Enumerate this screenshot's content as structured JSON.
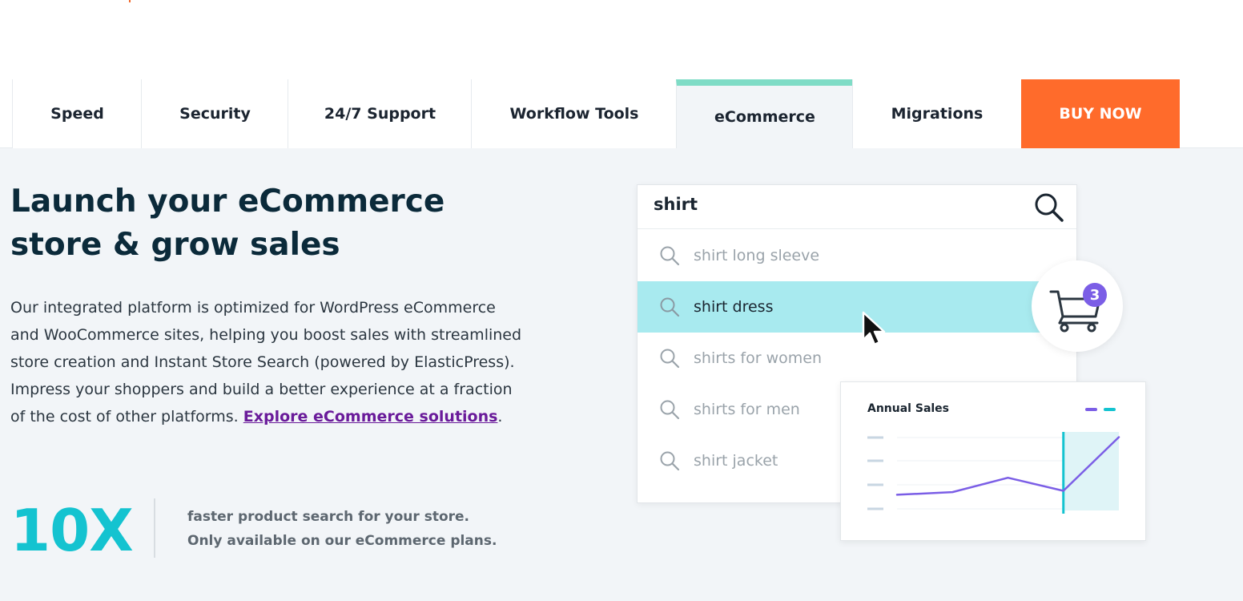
{
  "nav": {
    "tabs": [
      {
        "label": "Speed"
      },
      {
        "label": "Security"
      },
      {
        "label": "24/7 Support"
      },
      {
        "label": "Workflow Tools"
      },
      {
        "label": "eCommerce"
      },
      {
        "label": "Migrations"
      }
    ],
    "buy_label": "BUY NOW",
    "active_tab": "eCommerce"
  },
  "hero": {
    "title_line1": "Launch your eCommerce",
    "title_line2": "store & grow sales",
    "description": "Our integrated platform is optimized for WordPress eCommerce and WooCommerce sites, helping you boost sales with streamlined store creation and Instant Store Search (powered by ElasticPress). Impress your shoppers and build a better experience at a fraction of the cost of other platforms.",
    "link_text": "Explore eCommerce solutions",
    "after_link": "."
  },
  "stat": {
    "value": "10X",
    "text": "faster product search for your store. Only available on our eCommerce plans."
  },
  "search_demo": {
    "query": "shirt",
    "suggestions": [
      "shirt long sleeve",
      "shirt dress",
      "shirts for women",
      "shirts for men",
      "shirt jacket"
    ],
    "highlighted_index": 1
  },
  "cart": {
    "count": "3"
  },
  "chart_data": {
    "type": "line",
    "title": "Annual Sales",
    "series": [
      {
        "values": [
          1.2,
          1.4,
          2.5,
          1.5,
          5.6
        ],
        "color": "#7b5ee6"
      }
    ],
    "legend_colors": [
      "#7b5ee6",
      "#14c3d0"
    ],
    "highlight_from_index": 3,
    "highlight_color": "#14c3d0"
  },
  "colors": {
    "accent_orange": "#ff6b2b",
    "accent_teal": "#14c3d0",
    "tab_active_bar": "#7fdcc6",
    "link_purple": "#6a1b9a"
  },
  "icons": {
    "search": "search-icon",
    "cart": "shopping-cart-icon",
    "cursor": "mouse-cursor-icon"
  }
}
